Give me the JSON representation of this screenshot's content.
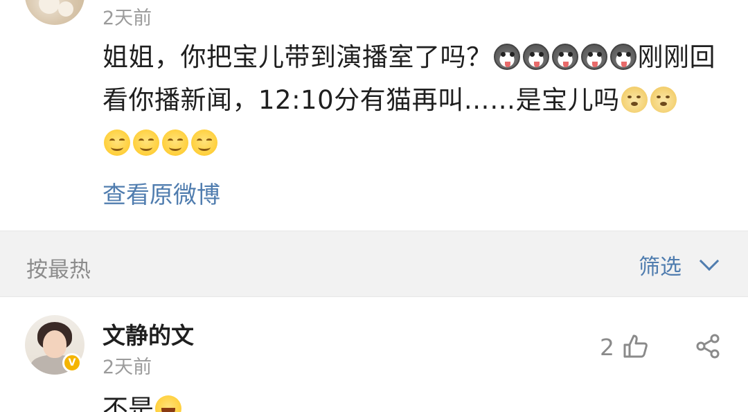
{
  "top_comment": {
    "time": "2天前",
    "body_part1": "姐姐，你把宝儿带到演播室了吗？",
    "body_part2": "刚刚回看你播新闻，12:10分有猫再叫……是宝儿吗",
    "emojis_after_part1": [
      "husky",
      "husky",
      "husky",
      "husky",
      "husky"
    ],
    "emojis_after_part2": [
      "doge",
      "doge"
    ],
    "emojis_line3": [
      "smile",
      "smile",
      "smile",
      "smile"
    ],
    "view_original_label": "查看原微博"
  },
  "sort_bar": {
    "sort_label": "按最热",
    "filter_label": "筛选"
  },
  "comment2": {
    "username": "文静的文",
    "verified_badge": "V",
    "time": "2天前",
    "like_count": "2",
    "text": "不是",
    "emoji": "laugh-cry"
  },
  "colors": {
    "link_blue": "#507daf",
    "gray_text": "#9b9b9b",
    "sort_bar_bg": "#f2f2f2",
    "badge_yellow": "#f4b400"
  }
}
